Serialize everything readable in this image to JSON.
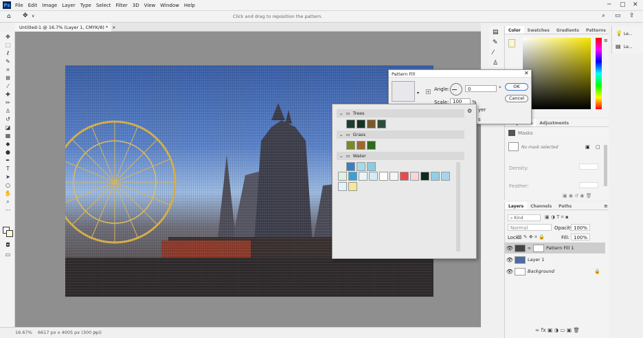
{
  "app": {
    "logo": "Ps"
  },
  "menu": [
    "File",
    "Edit",
    "Image",
    "Layer",
    "Type",
    "Select",
    "Filter",
    "3D",
    "View",
    "Window",
    "Help"
  ],
  "options_bar": {
    "hint": "Click and drag to reposition the pattern."
  },
  "document": {
    "tab_title": "Untitled-1 @ 16.7% (Layer 1, CMYK/8) *",
    "tab_close": "×"
  },
  "status": {
    "zoom": "16.67%",
    "doc_info": "6617 px x 4005 px (300 ppi)"
  },
  "color_panel": {
    "tabs": [
      "Color",
      "Swatches",
      "Gradients",
      "Patterns"
    ]
  },
  "properties_panel": {
    "tabs": [
      "Properties",
      "Adjustments"
    ],
    "masks_label": "Masks",
    "no_mask": "No mask selected",
    "density_label": "Density:",
    "feather_label": "Feather:"
  },
  "layers_panel": {
    "tabs": [
      "Layers",
      "Channels",
      "Paths"
    ],
    "kind_placeholder": "Kind",
    "blend_mode": "Normal",
    "opacity_label": "Opacity:",
    "opacity_value": "100%",
    "lock_label": "Lock:",
    "fill_label": "Fill:",
    "fill_value": "100%",
    "layers": [
      {
        "name": "Pattern Fill 1",
        "selected": true
      },
      {
        "name": "Layer 1",
        "selected": false
      },
      {
        "name": "Background",
        "selected": false,
        "italic": true
      }
    ]
  },
  "right_panel": {
    "items": [
      "Le...",
      "Le..."
    ]
  },
  "pattern_fill_dialog": {
    "title": "Pattern Fill",
    "angle_label": "Angle:",
    "angle_value": "0",
    "angle_unit": "°",
    "scale_label": "Scale:",
    "scale_value": "100",
    "scale_unit": "%",
    "link_label": "yer",
    "extra_label": "s",
    "ok": "OK",
    "cancel": "Cancel"
  },
  "pattern_picker": {
    "groups": [
      "Trees",
      "Grass",
      "Water"
    ],
    "colors": {
      "trees": [
        "#1e3d2f",
        "#173326",
        "#7a5a2c",
        "#2f4e3a"
      ],
      "grass": [
        "#7a8a2a",
        "#9c6a2a",
        "#2e6a1f"
      ],
      "water": [
        "#3a7fc4",
        "#a5dbe6",
        "#8fcbe0",
        "#dff1e2",
        "#3aa1d8",
        "#e8f4fa",
        "#d0ecf5",
        "#ffffff",
        "#f2f8f2",
        "#e94b4b",
        "#f7d6d6",
        "#0e2b1e",
        "#8fd0e6",
        "#a8d4ea",
        "#e3f3fb",
        "#f2e99a"
      ]
    }
  }
}
